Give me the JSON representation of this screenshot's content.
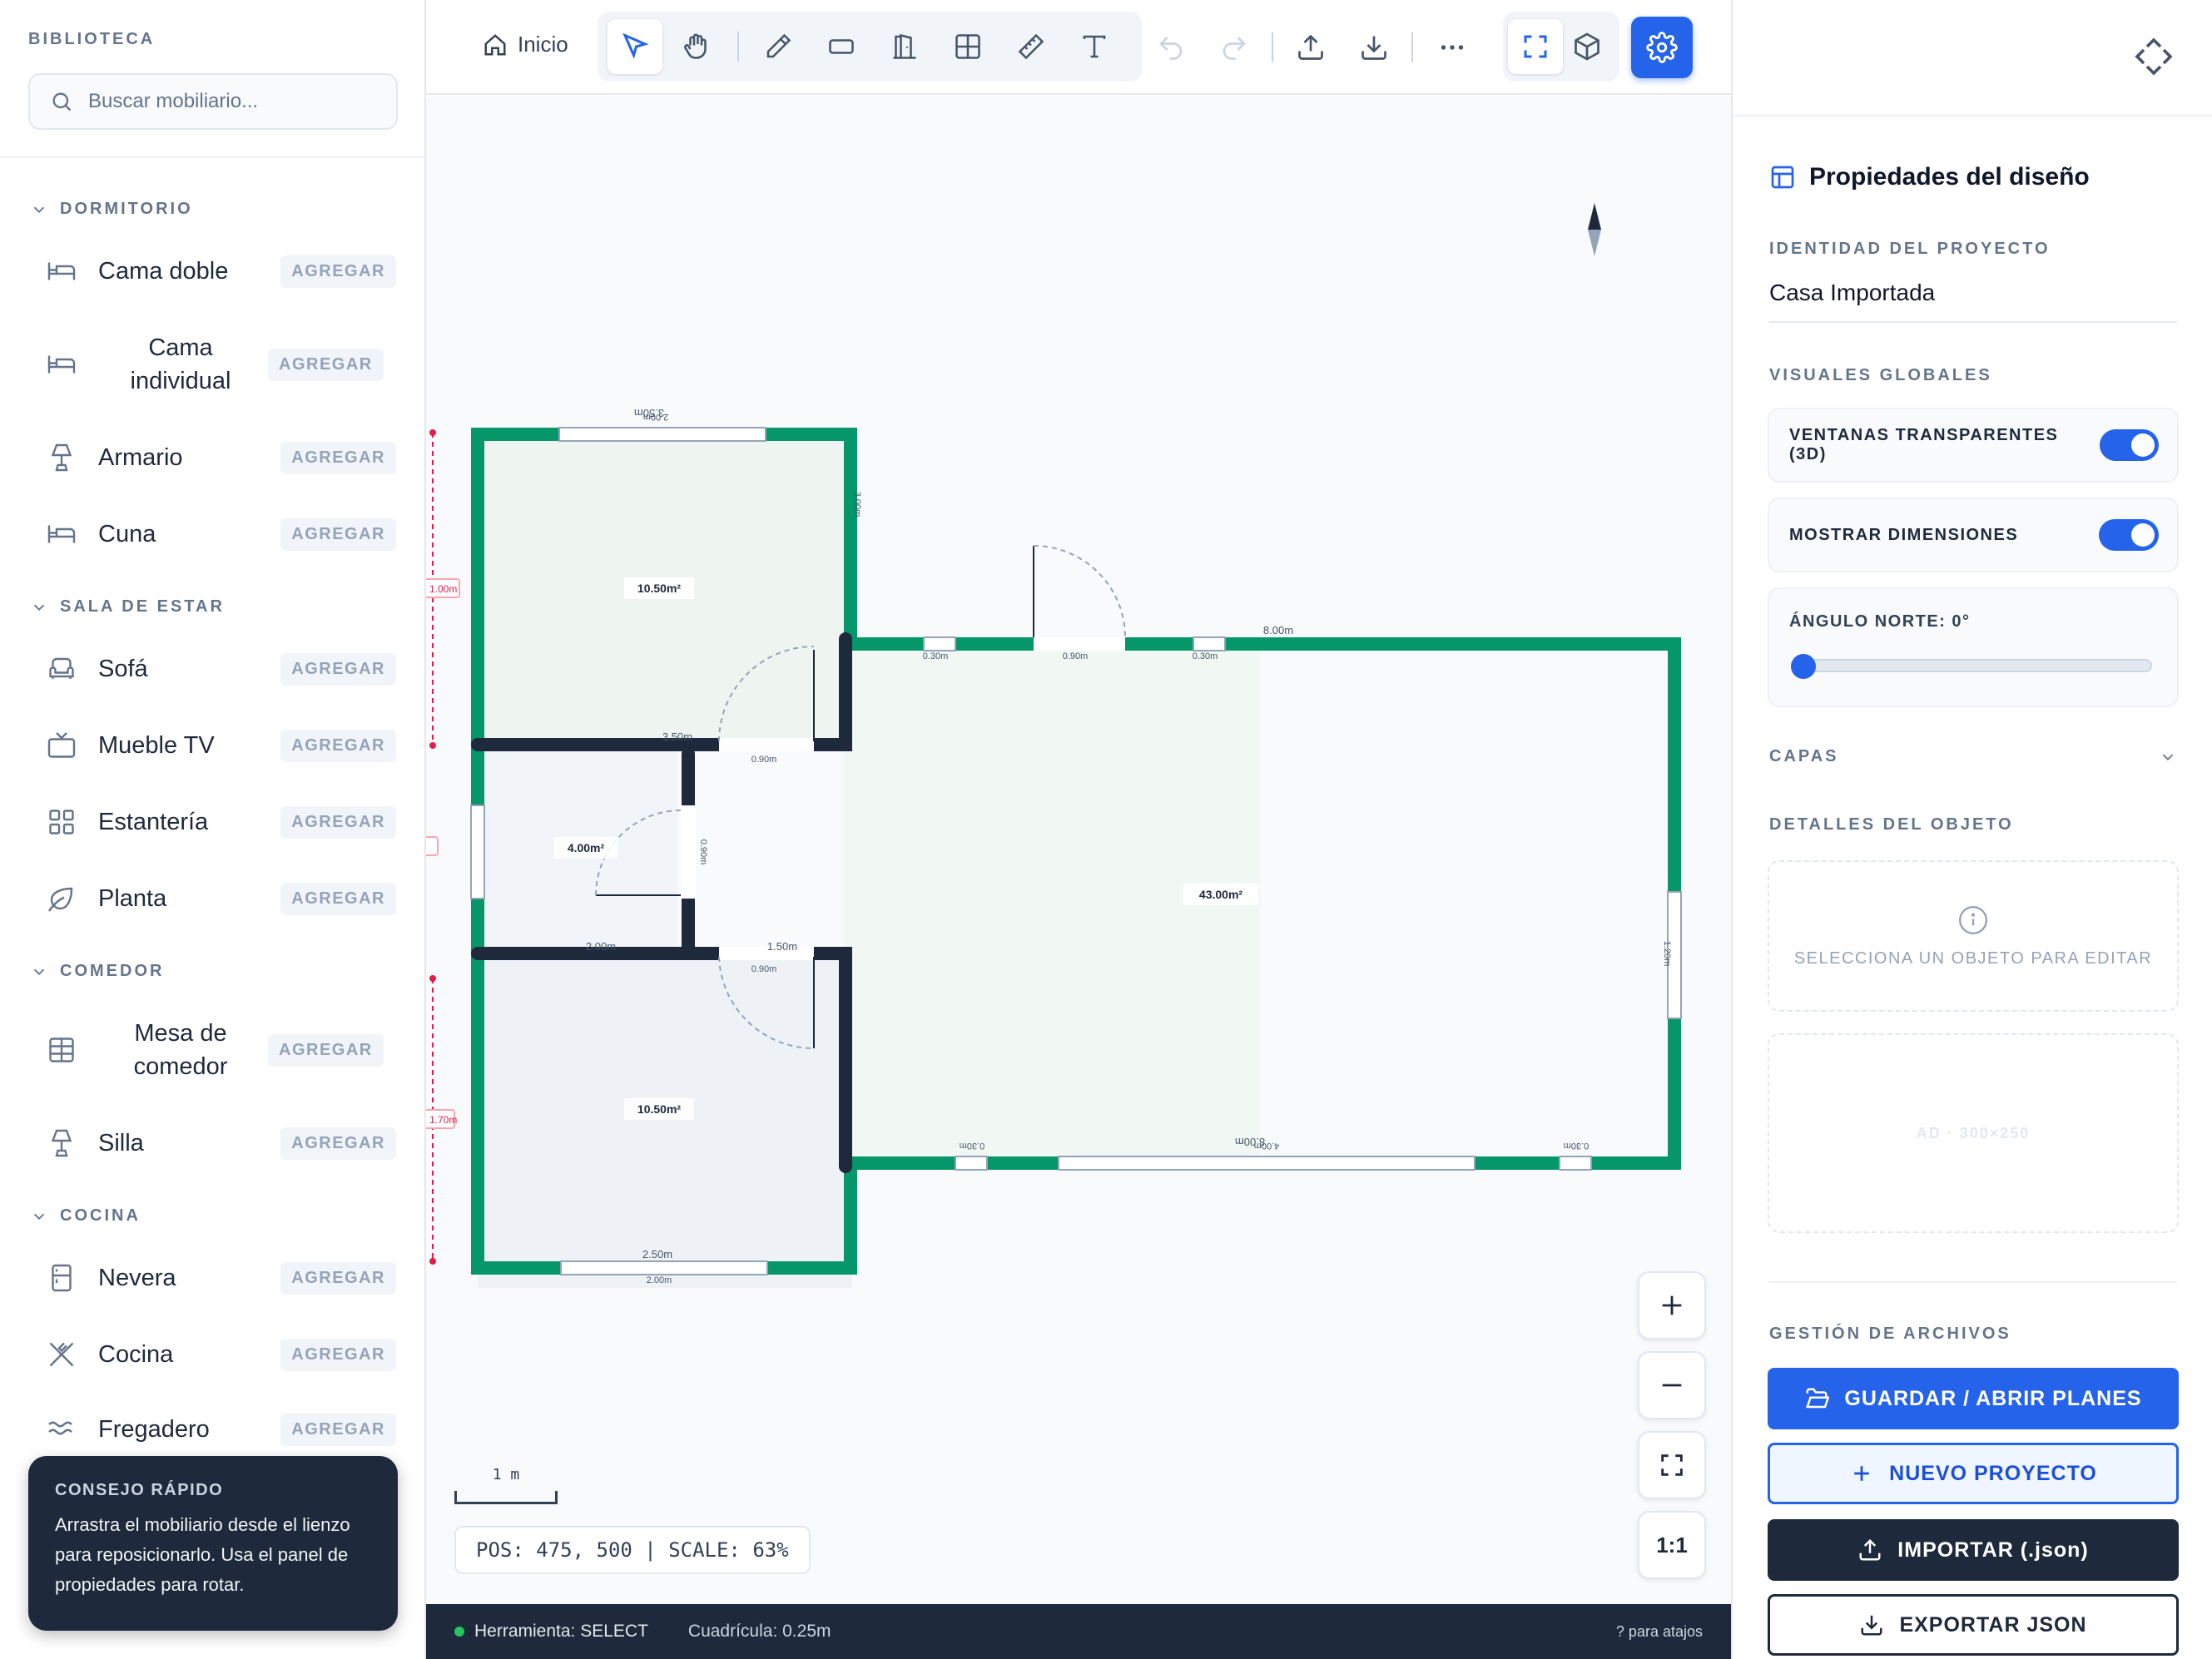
{
  "sidebar": {
    "title": "BIBLIOTECA",
    "search_placeholder": "Buscar mobiliario...",
    "add_label": "AGREGAR",
    "categories": [
      {
        "label": "DORMITORIO",
        "items": [
          {
            "label": "Cama doble",
            "icon": "bed-icon"
          },
          {
            "label": "Cama individual",
            "icon": "bed-icon"
          },
          {
            "label": "Armario",
            "icon": "lamp-icon"
          },
          {
            "label": "Cuna",
            "icon": "bed-icon"
          }
        ]
      },
      {
        "label": "SALA DE ESTAR",
        "items": [
          {
            "label": "Sofá",
            "icon": "sofa-icon"
          },
          {
            "label": "Mueble TV",
            "icon": "tv-icon"
          },
          {
            "label": "Estantería",
            "icon": "grid-icon"
          },
          {
            "label": "Planta",
            "icon": "leaf-icon"
          }
        ]
      },
      {
        "label": "COMEDOR",
        "items": [
          {
            "label": "Mesa de comedor",
            "icon": "table-icon"
          },
          {
            "label": "Silla",
            "icon": "lamp-icon"
          }
        ]
      },
      {
        "label": "COCINA",
        "items": [
          {
            "label": "Nevera",
            "icon": "fridge-icon"
          },
          {
            "label": "Cocina",
            "icon": "utensils-icon"
          },
          {
            "label": "Fregadero",
            "icon": "waves-icon"
          }
        ]
      }
    ],
    "tip": {
      "title": "CONSEJO RÁPIDO",
      "body": "Arrastra el mobiliario desde el lienzo para reposicionarlo. Usa el panel de propiedades para rotar."
    }
  },
  "toolbar": {
    "home_label": "Inicio",
    "tools": [
      "select-tool",
      "pan-tool",
      "draw-wall-tool",
      "room-tool",
      "door-tool",
      "window-tool",
      "measure-tool",
      "text-tool"
    ],
    "active_tool": "select-tool",
    "accent": "#2563eb"
  },
  "canvas": {
    "rooms": [
      {
        "area": "10.50m²"
      },
      {
        "area": "4.00m²"
      },
      {
        "area": "10.50m²"
      },
      {
        "area": "43.00m²"
      }
    ],
    "dimension_labels": [
      "2.00m",
      "3.50m",
      "3.00m",
      "8.00m",
      "3.50m",
      "2.00m",
      "1.50m",
      "0.90m",
      "0.90m",
      "0.90m",
      "0.30m",
      "0.30m",
      "0.30m",
      "0.30m",
      "4.00m",
      "8.00m",
      "1.20m",
      "0.90m",
      "2.50m",
      "2.00m",
      "1.00m",
      "1.70m"
    ],
    "scale_label": "1 m",
    "position_readout": "POS: 475, 500 | SCALE: 63%",
    "zoom_in": "+",
    "zoom_out": "−",
    "reset_label": "1:1",
    "wall_colors": {
      "exterior": "#059669",
      "interior": "#1e293b"
    }
  },
  "status": {
    "tool": "Herramienta: SELECT",
    "grid": "Cuadrícula: 0.25m",
    "help": "? para atajos"
  },
  "properties": {
    "title": "Propiedades del diseño",
    "identity_label": "IDENTIDAD DEL PROYECTO",
    "project_name": "Casa Importada",
    "visuals_label": "VISUALES GLOBALES",
    "toggle_windows": "VENTANAS TRANSPARENTES (3D)",
    "toggle_windows_on": true,
    "toggle_dimensions": "MOSTRAR DIMENSIONES",
    "toggle_dimensions_on": true,
    "north_label": "ÁNGULO NORTE: 0°",
    "north_value": 0,
    "layers_label": "CAPAS",
    "details_label": "DETALLES DEL OBJETO",
    "select_hint": "SELECCIONA UN OBJETO PARA EDITAR",
    "ad_label": "AD · 300×250",
    "files_label": "GESTIÓN DE ARCHIVOS",
    "btn_save": "GUARDAR / ABRIR PLANES",
    "btn_new": "NUEVO PROYECTO",
    "btn_import": "IMPORTAR (.json)",
    "btn_export": "EXPORTAR JSON"
  }
}
